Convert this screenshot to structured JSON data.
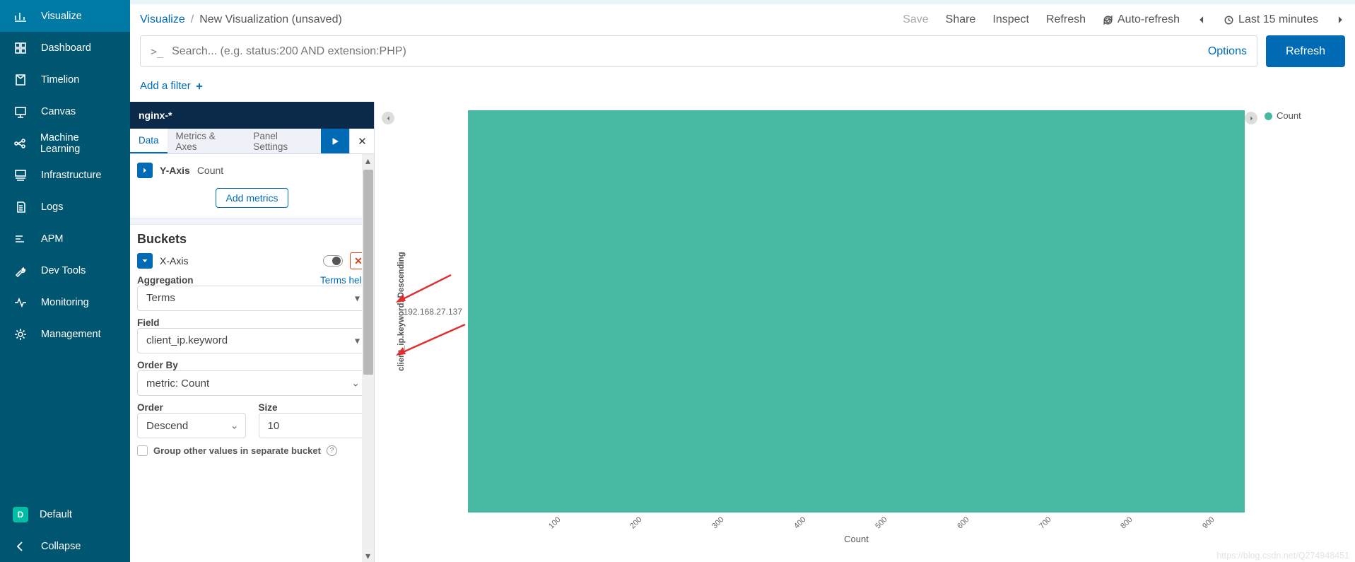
{
  "nav": {
    "items": [
      {
        "label": "Visualize",
        "active": true
      },
      {
        "label": "Dashboard"
      },
      {
        "label": "Timelion"
      },
      {
        "label": "Canvas"
      },
      {
        "label": "Machine Learning"
      },
      {
        "label": "Infrastructure"
      },
      {
        "label": "Logs"
      },
      {
        "label": "APM"
      },
      {
        "label": "Dev Tools"
      },
      {
        "label": "Monitoring"
      },
      {
        "label": "Management"
      }
    ],
    "space_letter": "D",
    "default_label": "Default",
    "collapse_label": "Collapse"
  },
  "breadcrumb": {
    "root": "Visualize",
    "current": "New Visualization (unsaved)"
  },
  "top_actions": {
    "save": "Save",
    "share": "Share",
    "inspect": "Inspect",
    "refresh": "Refresh",
    "auto_refresh": "Auto-refresh",
    "time_range": "Last 15 minutes"
  },
  "search": {
    "placeholder": "Search... (e.g. status:200 AND extension:PHP)",
    "options": "Options",
    "refresh_button": "Refresh"
  },
  "filter_bar": {
    "add_filter": "Add a filter"
  },
  "editor": {
    "index_pattern": "nginx-*",
    "tabs": [
      "Data",
      "Metrics & Axes",
      "Panel Settings"
    ],
    "active_tab": 0,
    "metrics": {
      "y_axis_label": "Y-Axis",
      "y_axis_value": "Count",
      "add_metrics": "Add metrics"
    },
    "buckets": {
      "title": "Buckets",
      "x_axis_label": "X-Axis",
      "aggregation_label": "Aggregation",
      "terms_help": "Terms help",
      "aggregation_value": "Terms",
      "field_label": "Field",
      "field_value": "client_ip.keyword",
      "orderby_label": "Order By",
      "orderby_value": "metric: Count",
      "order_label": "Order",
      "order_value": "Descend",
      "size_label": "Size",
      "size_value": "10",
      "group_other": "Group other values in separate bucket"
    }
  },
  "chart_data": {
    "type": "bar",
    "orientation": "horizontal",
    "title": "",
    "xlabel": "Count",
    "ylabel": "client_ip.keyword: Descending",
    "categories": [
      "192.168.27.137"
    ],
    "values": [
      950
    ],
    "x_ticks": [
      100,
      200,
      300,
      400,
      500,
      600,
      700,
      800,
      900
    ],
    "xlim": [
      0,
      950
    ],
    "legend": [
      "Count"
    ],
    "color": "#47b9a3"
  },
  "watermark": "https://blog.csdn.net/Q274948451"
}
